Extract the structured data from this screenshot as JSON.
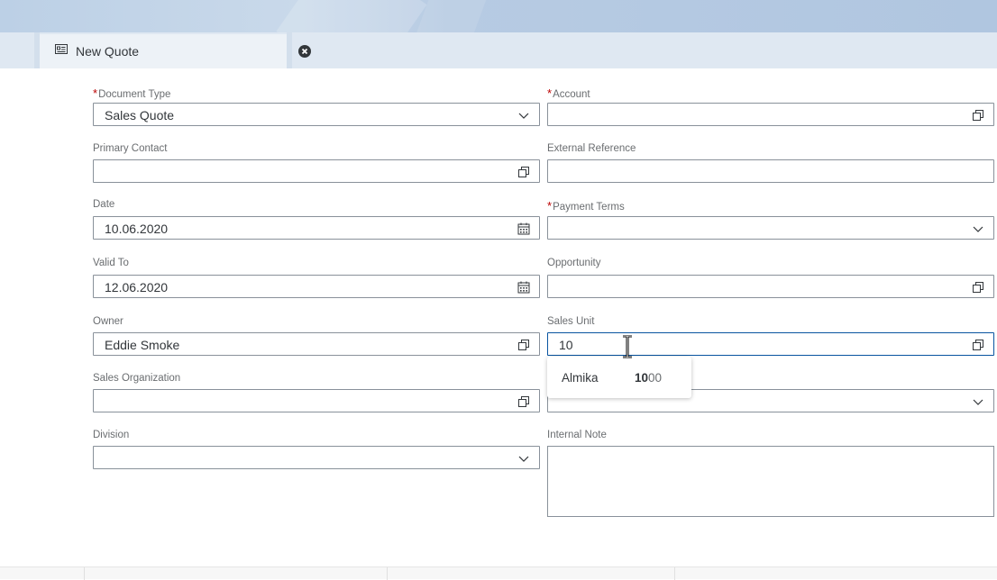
{
  "tab": {
    "label": "New Quote"
  },
  "form": {
    "document_type": {
      "label": "Document Type",
      "required": true,
      "value": "Sales Quote"
    },
    "account": {
      "label": "Account",
      "required": true,
      "value": ""
    },
    "primary_contact": {
      "label": "Primary Contact",
      "value": ""
    },
    "external_reference": {
      "label": "External Reference",
      "value": ""
    },
    "date": {
      "label": "Date",
      "value": "10.06.2020"
    },
    "payment_terms": {
      "label": "Payment Terms",
      "required": true,
      "value": ""
    },
    "valid_to": {
      "label": "Valid To",
      "value": "12.06.2020"
    },
    "opportunity": {
      "label": "Opportunity",
      "value": ""
    },
    "owner": {
      "label": "Owner",
      "value": "Eddie Smoke"
    },
    "sales_unit": {
      "label": "Sales Unit",
      "value": "10"
    },
    "sales_organization": {
      "label": "Sales Organization",
      "value": ""
    },
    "division": {
      "label": "Division",
      "value": ""
    },
    "internal_note": {
      "label": "Internal Note",
      "value": ""
    }
  },
  "suggestion": {
    "name": "Almika",
    "code_match": "10",
    "code_rest": "00"
  },
  "colors": {
    "required": "#bb0000",
    "focus_border": "#0854a0",
    "field_border": "#89919a"
  }
}
